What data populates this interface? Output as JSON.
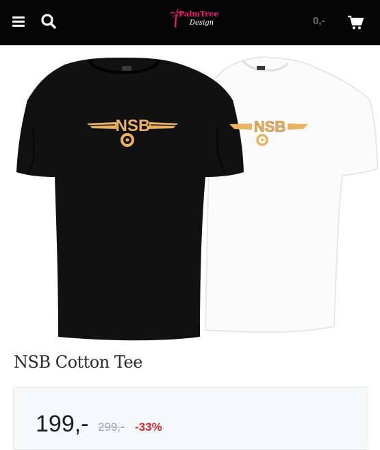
{
  "header": {
    "logo_line1": "PalmTree",
    "logo_line2": "Design",
    "cart_total": "0,-",
    "icons": [
      "menu-icon",
      "search-icon",
      "palm-tree-logo",
      "cart-icon"
    ]
  },
  "product": {
    "title": "NSB Cotton Tee",
    "logo_text": "NSB",
    "price_current": "199,-",
    "price_old": "299,-",
    "discount": "-33%"
  },
  "colors": {
    "header_bg": "#050505",
    "logo_pink": "#e81a74",
    "badge_gold": "#e9b35f",
    "discount_red": "#e0262b"
  }
}
